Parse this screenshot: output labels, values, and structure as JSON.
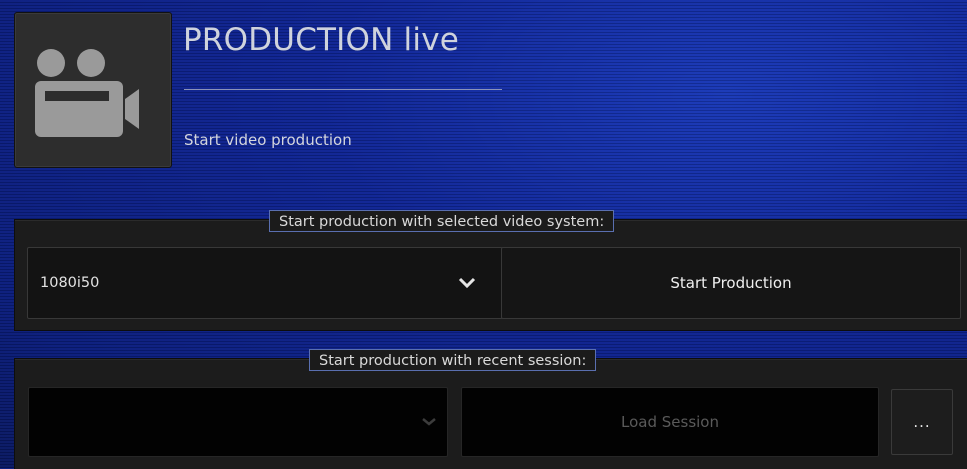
{
  "header": {
    "title": "PRODUCTION live",
    "subtitle": "Start video production",
    "icon": "video-camera-icon"
  },
  "video_system_section": {
    "legend": "Start production with selected video system:",
    "select_value": "1080i50",
    "start_button_label": "Start Production"
  },
  "session_section": {
    "legend": "Start production with recent session:",
    "select_value": "",
    "load_button_label": "Load Session",
    "browse_button_label": "..."
  },
  "colors": {
    "background_blue": "#0b1e8a",
    "panel_dark": "#1c1c1c",
    "legend_border": "#5a6fb0"
  }
}
